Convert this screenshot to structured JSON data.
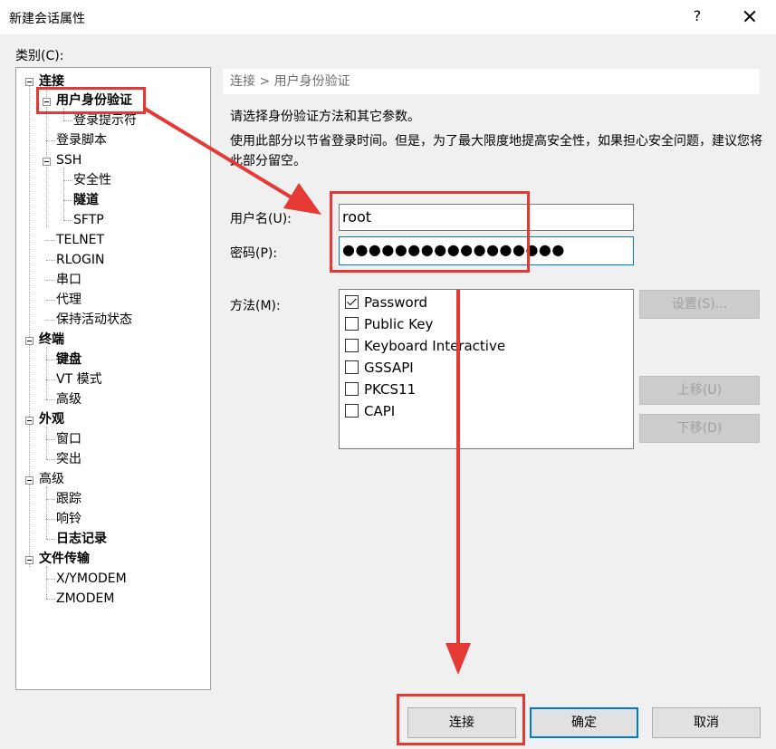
{
  "window": {
    "title": "新建会话属性",
    "help_label": "?"
  },
  "category_label": "类别(C):",
  "tree": {
    "items": [
      {
        "label": "连接",
        "bold": true
      },
      {
        "label": "用户身份验证",
        "bold": true,
        "selected": true
      },
      {
        "label": "登录提示符",
        "bold": false
      },
      {
        "label": "登录脚本",
        "bold": false
      },
      {
        "label": "SSH",
        "bold": false
      },
      {
        "label": "安全性",
        "bold": false
      },
      {
        "label": "隧道",
        "bold": true
      },
      {
        "label": "SFTP",
        "bold": false
      },
      {
        "label": "TELNET",
        "bold": false
      },
      {
        "label": "RLOGIN",
        "bold": false
      },
      {
        "label": "串口",
        "bold": false
      },
      {
        "label": "代理",
        "bold": false
      },
      {
        "label": "保持活动状态",
        "bold": false
      },
      {
        "label": "终端",
        "bold": true
      },
      {
        "label": "键盘",
        "bold": true
      },
      {
        "label": "VT 模式",
        "bold": false
      },
      {
        "label": "高级",
        "bold": false
      },
      {
        "label": "外观",
        "bold": true
      },
      {
        "label": "窗口",
        "bold": false
      },
      {
        "label": "突出",
        "bold": false
      },
      {
        "label": "高级",
        "bold": false
      },
      {
        "label": "跟踪",
        "bold": false
      },
      {
        "label": "响铃",
        "bold": false
      },
      {
        "label": "日志记录",
        "bold": true
      },
      {
        "label": "文件传输",
        "bold": true
      },
      {
        "label": "X/YMODEM",
        "bold": false
      },
      {
        "label": "ZMODEM",
        "bold": false
      }
    ]
  },
  "panel": {
    "breadcrumb": "连接 > 用户身份验证",
    "description": "请选择身份验证方法和其它参数。",
    "note": "使用此部分以节省登录时间。但是，为了最大限度地提高安全性，如果担心安全问题，建议您将此部分留空。",
    "username_label": "用户名(U):",
    "username_value": "root",
    "password_label": "密码(P):",
    "password_value": "●●●●●●●●●●●●●●●●●",
    "method_label": "方法(M):",
    "methods": [
      {
        "label": "Password",
        "checked": true
      },
      {
        "label": "Public Key",
        "checked": false
      },
      {
        "label": "Keyboard Interactive",
        "checked": false
      },
      {
        "label": "GSSAPI",
        "checked": false
      },
      {
        "label": "PKCS11",
        "checked": false
      },
      {
        "label": "CAPI",
        "checked": false
      }
    ],
    "settings_button": "设置(S)...",
    "move_up_button": "上移(U)",
    "move_down_button": "下移(D)"
  },
  "footer": {
    "connect_button": "连接",
    "ok_button": "确定",
    "cancel_button": "取消"
  },
  "colors": {
    "annotation_red": "#e53935",
    "focus_blue": "#0078d7"
  }
}
